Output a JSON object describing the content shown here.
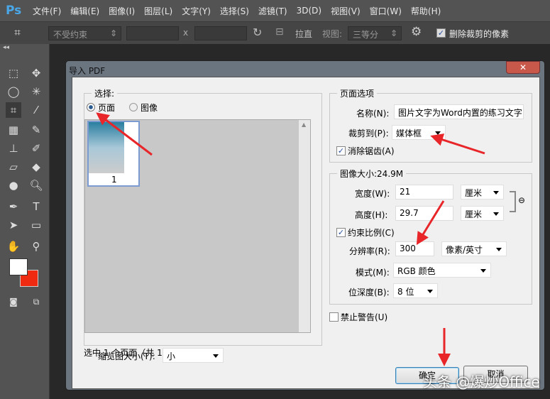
{
  "app": {
    "logo": "Ps",
    "menus": [
      "文件(F)",
      "编辑(E)",
      "图像(I)",
      "图层(L)",
      "文字(Y)",
      "选择(S)",
      "滤镜(T)",
      "3D(D)",
      "视图(V)",
      "窗口(W)",
      "帮助(H)"
    ]
  },
  "options": {
    "constraint": "不受约束",
    "x_label": "x",
    "straighten": "拉直",
    "view_label": "视图:",
    "view_value": "三等分",
    "delete_cropped": "删除裁剪的像素",
    "delete_cropped_checked": true
  },
  "dialog": {
    "title": "导入 PDF",
    "close": "✕",
    "select": {
      "label": "选择:",
      "radio_page": "页面",
      "radio_image": "图像",
      "selected": "页面",
      "thumb_number": "1",
      "status": "选中 1 个页面（共 1 个）",
      "thumb_size_label": "缩览图大小(T):",
      "thumb_size_value": "小"
    },
    "page_options": {
      "label": "页面选项",
      "name_label": "名称(N):",
      "name_value": "图片文字为Word内置的练习文字",
      "crop_label": "裁剪到(P):",
      "crop_value": "媒体框",
      "antialias": "消除锯齿(A)",
      "antialias_checked": true
    },
    "image_size": {
      "label": "图像大小:24.9M",
      "width_label": "宽度(W):",
      "width_value": "21",
      "width_unit": "厘米",
      "height_label": "高度(H):",
      "height_value": "29.7",
      "height_unit": "厘米",
      "constrain": "约束比例(C)",
      "constrain_checked": true,
      "res_label": "分辨率(R):",
      "res_value": "300",
      "res_unit": "像素/英寸",
      "mode_label": "模式(M):",
      "mode_value": "RGB 颜色",
      "depth_label": "位深度(B):",
      "depth_value": "8 位"
    },
    "suppress": "禁止警告(U)",
    "suppress_checked": false,
    "ok": "确定",
    "cancel": "取消"
  },
  "watermark": "头条 @爆炒Office",
  "colors": {
    "accent": "#e8262a",
    "foreground": "#ffffff",
    "background": "#ee2a10"
  }
}
